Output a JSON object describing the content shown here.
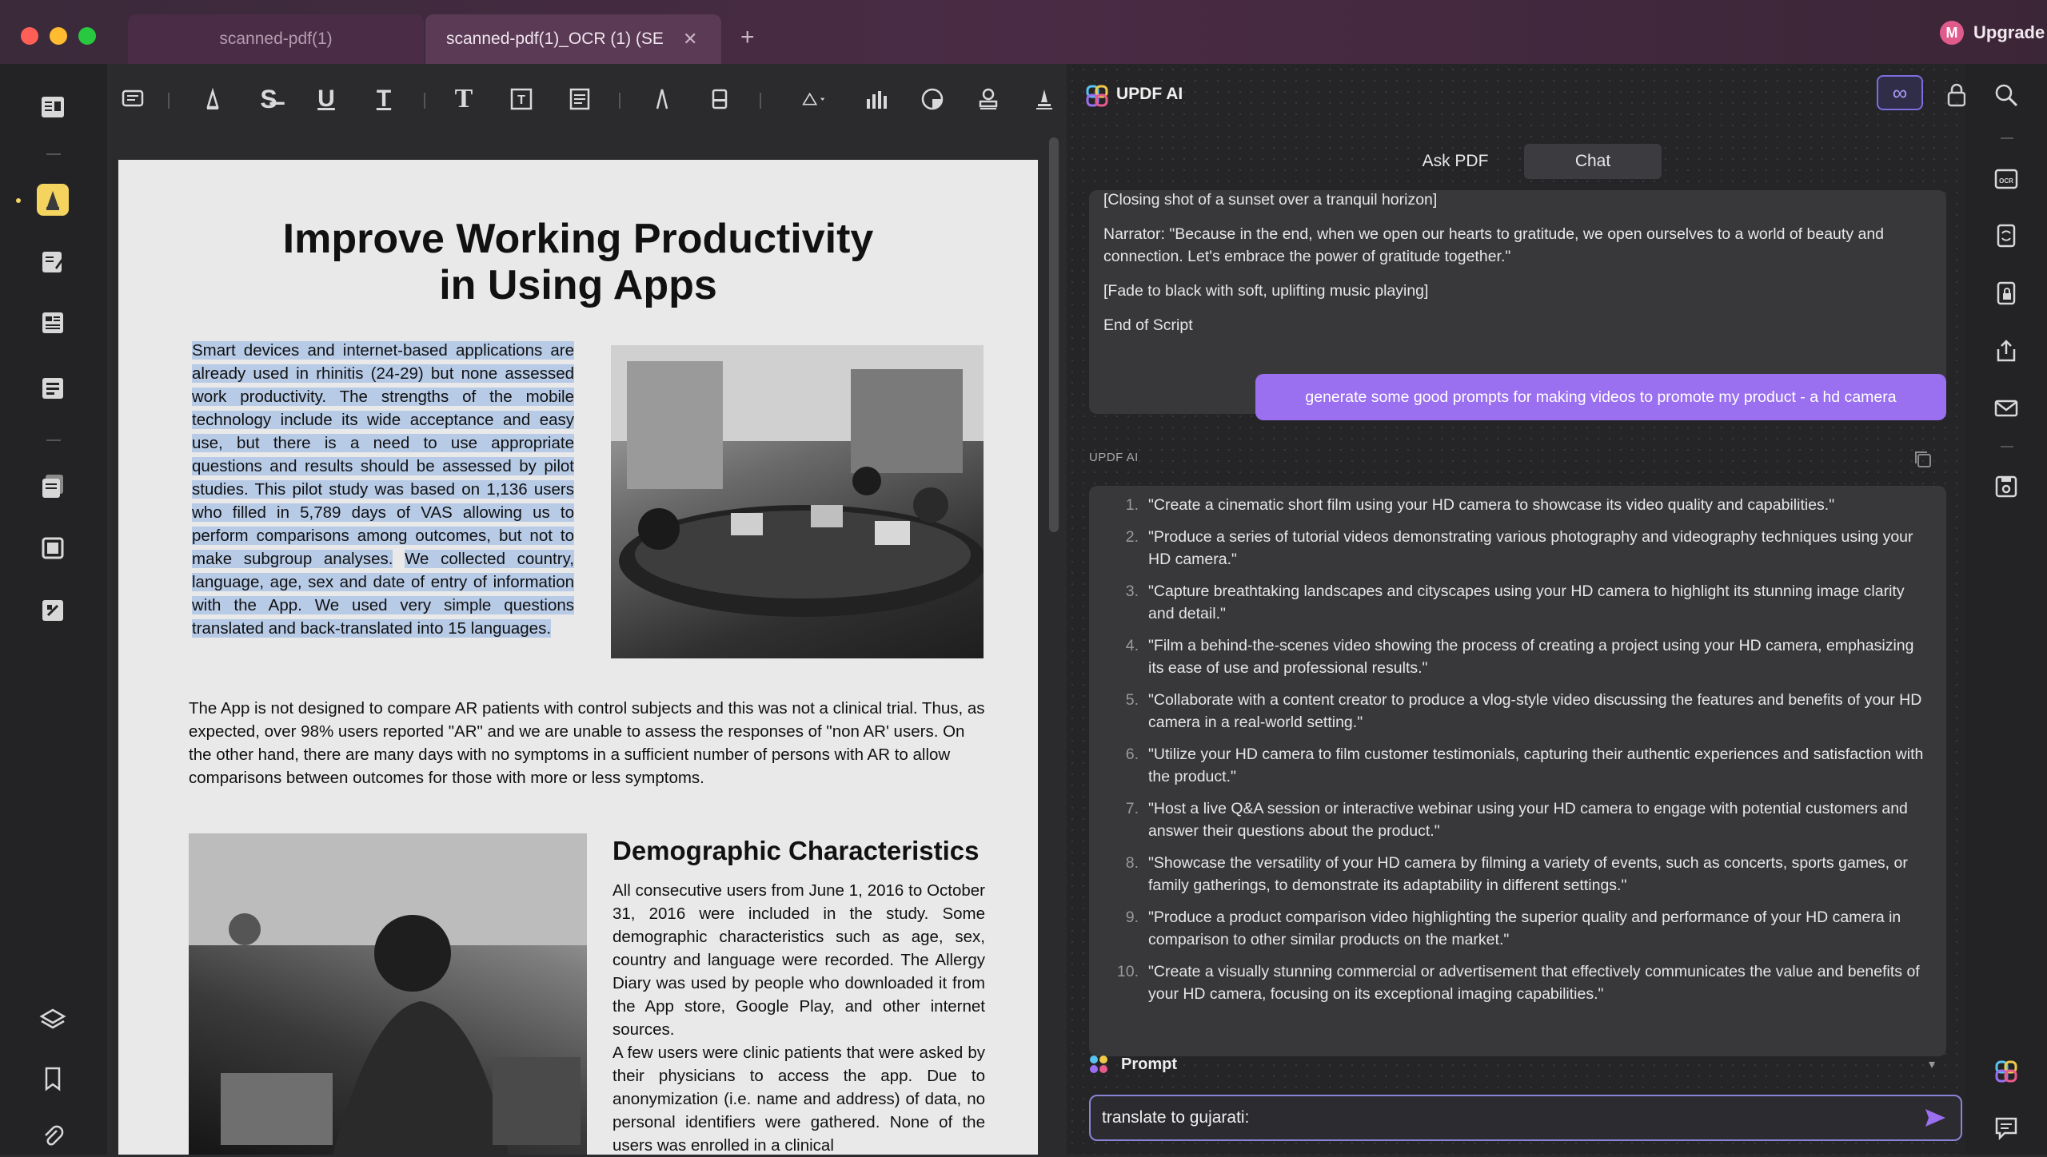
{
  "titlebar": {
    "tabs": [
      {
        "label": "scanned-pdf(1)"
      },
      {
        "label": "scanned-pdf(1)_OCR (1) (SE"
      }
    ],
    "new_tab": "+",
    "close": "✕",
    "upgrade_label": "Upgrade",
    "avatar_letter": "M"
  },
  "document": {
    "title_line1": "Improve Working Productivity",
    "title_line2": "in Using Apps",
    "para1": "Smart devices and internet-based applications are already used in rhinitis (24-29) but none assessed work productivity. The strengths of the mobile technology include its wide acceptance and easy use, but there is a need to use appropriate questions and results should be assessed by pilot studies. This pilot study was based on 1,136 users who filled in 5,789 days of VAS allowing us to perform comparisons among outcomes, but not to make subgroup analyses.",
    "para1b": "We collected country, language, age, sex and date of entry of information with the App. We used very simple questions translated and back-translated into 15 languages.",
    "para2": "The App is not designed to compare AR patients with control subjects and this was not a clinical trial. Thus, as expected, over 98% users reported \"AR\" and we are unable to assess the responses of \"non AR' users. On the other hand, there are many days with no symptoms in a sufficient number of persons with AR to allow comparisons between outcomes for those with more or less symptoms.",
    "section_title": "Demographic Characteristics",
    "para3": "All consecutive users from June 1, 2016 to October 31, 2016 were included in the study. Some demographic characteristics such as age, sex, country and language were recorded. The Allergy Diary was used by people who downloaded it from the App store, Google Play, and other internet sources.",
    "para3b": "A few users were clinic patients that were asked by their physicians to access the app. Due to anonymization (i.e. name and address) of data, no personal identifiers were gathered. None of the users was enrolled in a clinical"
  },
  "ai": {
    "title": "UPDF AI",
    "infinity": "∞",
    "modes": {
      "ask": "Ask PDF",
      "chat": "Chat"
    },
    "script_lines": [
      "[Closing shot of a sunset over a tranquil horizon]",
      "Narrator: \"Because in the end, when we open our hearts to gratitude, we open ourselves to a world of beauty and connection. Let's embrace the power of gratitude together.\"",
      "[Fade to black with soft, uplifting music playing]",
      "End of Script"
    ],
    "user_message": "generate some good prompts for making videos to promote my product - a hd camera",
    "responder_label": "UPDF AI",
    "answers": [
      {
        "num": "1.",
        "text": "\"Create a cinematic short film using your HD camera to showcase its video quality and capabilities.\""
      },
      {
        "num": "2.",
        "text": "\"Produce a series of tutorial videos demonstrating various photography and videography techniques using your HD camera.\""
      },
      {
        "num": "3.",
        "text": "\"Capture breathtaking landscapes and cityscapes using your HD camera to highlight its stunning image clarity and detail.\""
      },
      {
        "num": "4.",
        "text": "\"Film a behind-the-scenes video showing the process of creating a project using your HD camera, emphasizing its ease of use and professional results.\""
      },
      {
        "num": "5.",
        "text": "\"Collaborate with a content creator to produce a vlog-style video discussing the features and benefits of your HD camera in a real-world setting.\""
      },
      {
        "num": "6.",
        "text": "\"Utilize your HD camera to film customer testimonials, capturing their authentic experiences and satisfaction with the product.\""
      },
      {
        "num": "7.",
        "text": "\"Host a live Q&A session or interactive webinar using your HD camera to engage with potential customers and answer their questions about the product.\""
      },
      {
        "num": "8.",
        "text": "\"Showcase the versatility of your HD camera by filming a variety of events, such as concerts, sports games, or family gatherings, to demonstrate its adaptability in different settings.\""
      },
      {
        "num": "9.",
        "text": "\"Produce a product comparison video highlighting the superior quality and performance of your HD camera in comparison to other similar products on the market.\""
      },
      {
        "num": "10.",
        "text": "\"Create a visually stunning commercial or advertisement that effectively communicates the value and benefits of your HD camera, focusing on its exceptional imaging capabilities.\""
      }
    ],
    "prompt_label": "Prompt",
    "input_value": "translate to gujarati:"
  },
  "colors": {
    "accent": "#9a6ff0",
    "highlight": "#b7cae6",
    "active_tool": "#f4d35e"
  }
}
